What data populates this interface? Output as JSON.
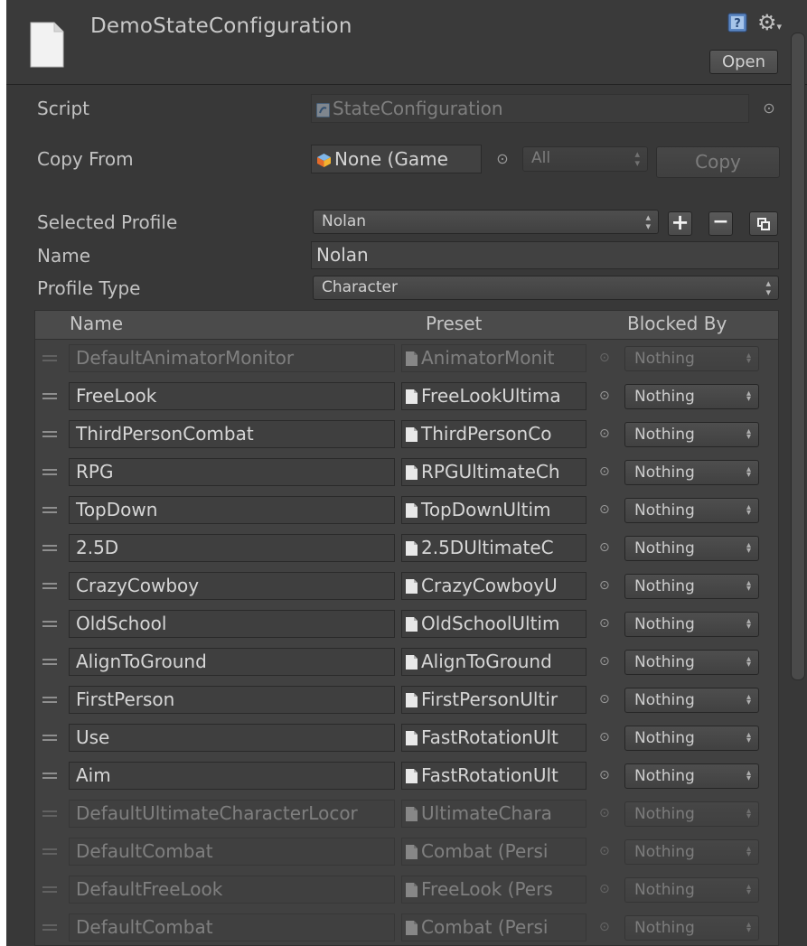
{
  "header": {
    "title": "DemoStateConfiguration",
    "open_label": "Open"
  },
  "properties": {
    "script": {
      "label": "Script",
      "value": "StateConfiguration"
    },
    "copy_from": {
      "label": "Copy From",
      "value": "None (Game",
      "filter": "All",
      "copy_label": "Copy"
    },
    "selected_profile": {
      "label": "Selected Profile",
      "value": "Nolan",
      "add_label": "+",
      "remove_label": "−"
    },
    "name": {
      "label": "Name",
      "value": "Nolan"
    },
    "profile_type": {
      "label": "Profile Type",
      "value": "Character"
    }
  },
  "states": {
    "columns": {
      "name": "Name",
      "preset": "Preset",
      "blocked_by": "Blocked By"
    },
    "rows": [
      {
        "name": "DefaultAnimatorMonitor",
        "preset": "AnimatorMonit",
        "blocked": "Nothing",
        "enabled": false
      },
      {
        "name": "FreeLook",
        "preset": "FreeLookUltima",
        "blocked": "Nothing",
        "enabled": true
      },
      {
        "name": "ThirdPersonCombat",
        "preset": "ThirdPersonCo",
        "blocked": "Nothing",
        "enabled": true
      },
      {
        "name": "RPG",
        "preset": "RPGUltimateCh",
        "blocked": "Nothing",
        "enabled": true
      },
      {
        "name": "TopDown",
        "preset": "TopDownUltim",
        "blocked": "Nothing",
        "enabled": true
      },
      {
        "name": "2.5D",
        "preset": "2.5DUltimateC",
        "blocked": "Nothing",
        "enabled": true
      },
      {
        "name": "CrazyCowboy",
        "preset": "CrazyCowboyU",
        "blocked": "Nothing",
        "enabled": true
      },
      {
        "name": "OldSchool",
        "preset": "OldSchoolUltim",
        "blocked": "Nothing",
        "enabled": true
      },
      {
        "name": "AlignToGround",
        "preset": "AlignToGround",
        "blocked": "Nothing",
        "enabled": true
      },
      {
        "name": "FirstPerson",
        "preset": "FirstPersonUltir",
        "blocked": "Nothing",
        "enabled": true
      },
      {
        "name": "Use",
        "preset": "FastRotationUlt",
        "blocked": "Nothing",
        "enabled": true
      },
      {
        "name": "Aim",
        "preset": "FastRotationUlt",
        "blocked": "Nothing",
        "enabled": true
      },
      {
        "name": "DefaultUltimateCharacterLocor",
        "preset": "UltimateChara",
        "blocked": "Nothing",
        "enabled": false
      },
      {
        "name": "DefaultCombat",
        "preset": "Combat (Persi",
        "blocked": "Nothing",
        "enabled": false
      },
      {
        "name": "DefaultFreeLook",
        "preset": "FreeLook (Pers",
        "blocked": "Nothing",
        "enabled": false
      },
      {
        "name": "DefaultCombat",
        "preset": "Combat (Persi",
        "blocked": "Nothing",
        "enabled": false
      }
    ]
  }
}
